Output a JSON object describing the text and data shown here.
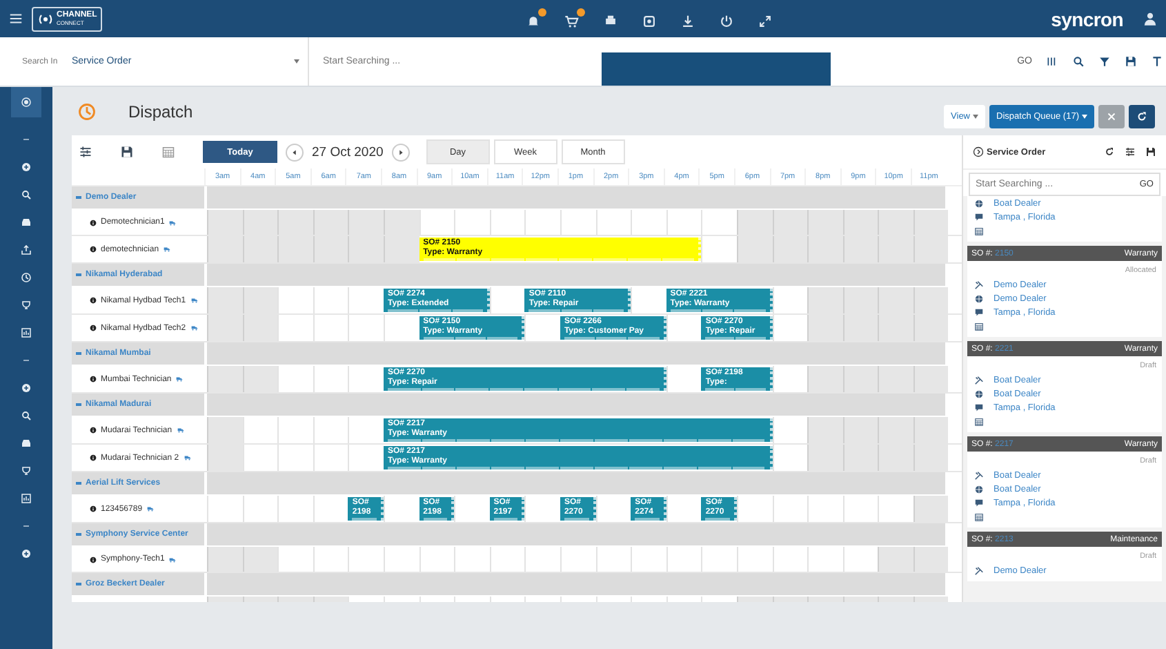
{
  "topbar": {
    "logo": "CHANNEL",
    "logo_sub": "CONNECT",
    "brand": "syncron",
    "notifications": [
      {
        "badge": true
      },
      {
        "badge": true
      },
      {
        "badge": false
      },
      {
        "badge": false
      },
      {
        "badge": false
      },
      {
        "badge": false
      },
      {
        "badge": false
      }
    ]
  },
  "searchbar": {
    "label": "Search In",
    "scope": "Service Order",
    "placeholder": "Start Searching ...",
    "go": "GO"
  },
  "page": {
    "title": "Dispatch",
    "view": "View",
    "queue": "Dispatch Queue (17)"
  },
  "toolbar": {
    "today": "Today",
    "date": "27 Oct 2020",
    "views": [
      {
        "label": "Day",
        "selected": true
      },
      {
        "label": "Week",
        "selected": false
      },
      {
        "label": "Month",
        "selected": false
      }
    ]
  },
  "hours": [
    "3am",
    "4am",
    "5am",
    "6am",
    "7am",
    "8am",
    "9am",
    "10am",
    "11am",
    "12pm",
    "1pm",
    "2pm",
    "3pm",
    "4pm",
    "5pm",
    "6pm",
    "7pm",
    "8pm",
    "9pm",
    "10pm",
    "11pm"
  ],
  "groups": [
    {
      "name": "Demo Dealer",
      "technicians": [
        {
          "name": "Demotechnician1",
          "slots": [
            {
              "available": false
            },
            {
              "available": false
            },
            {
              "available": false
            },
            {
              "available": false
            },
            {
              "available": false
            },
            {
              "available": false
            },
            {
              "available": true
            },
            {
              "available": true
            },
            {
              "available": true
            },
            {
              "available": true
            },
            {
              "available": true
            },
            {
              "available": true
            },
            {
              "available": true
            },
            {
              "available": true
            },
            {
              "available": true
            },
            {
              "available": false
            },
            {
              "available": false
            },
            {
              "available": false
            },
            {
              "available": false
            },
            {
              "available": false
            },
            {
              "available": false
            }
          ]
        },
        {
          "name": "demotechnician",
          "slots": [
            {
              "available": false
            },
            {
              "available": false
            },
            {
              "available": false
            },
            {
              "available": false
            },
            {
              "available": false
            },
            {
              "available": false
            },
            {
              "event": {
                "so": "SO# 2150",
                "type": "Type: Warranty",
                "color": "#ffff00"
              }
            },
            {
              "continued": true
            },
            {
              "continued": true
            },
            {
              "continued": true
            },
            {
              "continued": true
            },
            {
              "continued": true
            },
            {
              "continued": true
            },
            {
              "continued": true
            },
            {
              "available": true
            },
            {
              "available": false
            },
            {
              "available": false
            },
            {
              "available": false
            },
            {
              "available": false
            },
            {
              "available": false
            },
            {
              "available": false
            }
          ]
        }
      ]
    },
    {
      "name": "Nikamal Hyderabad",
      "technicians": [
        {
          "name": "Nikamal Hydbad Tech1",
          "slots": [
            {
              "available": false
            },
            {
              "available": false
            },
            {
              "available": true
            },
            {
              "available": true
            },
            {
              "available": true
            },
            {
              "event": {
                "so": "SO# 2274",
                "type": "Type: Extended",
                "color": "#1b8ea6"
              }
            },
            {
              "continued": true
            },
            {
              "continued": true
            },
            {
              "available": true
            },
            {
              "event": {
                "so": "SO# 2110",
                "type": "Type: Repair",
                "color": "#1b8ea6"
              }
            },
            {
              "continued": true
            },
            {
              "continued": true
            },
            {
              "available": true
            },
            {
              "event": {
                "so": "SO# 2221",
                "type": "Type: Warranty",
                "color": "#1b8ea6"
              }
            },
            {
              "continued": true
            },
            {
              "continued": true
            },
            {
              "available": true
            },
            {
              "available": false
            },
            {
              "available": false
            },
            {
              "available": false
            },
            {
              "available": false
            }
          ]
        },
        {
          "name": "Nikamal Hydbad Tech2",
          "slots": [
            {
              "available": false
            },
            {
              "available": false
            },
            {
              "available": true
            },
            {
              "available": true
            },
            {
              "available": true
            },
            {
              "available": true
            },
            {
              "event": {
                "so": "SO# 2150",
                "type": "Type: Warranty",
                "color": "#1b8ea6"
              }
            },
            {
              "continued": true
            },
            {
              "continued": true
            },
            {
              "available": true
            },
            {
              "event": {
                "so": "SO# 2266",
                "type": "Type: Customer Pay",
                "color": "#1b8ea6"
              }
            },
            {
              "continued": true
            },
            {
              "continued": true
            },
            {
              "available": true
            },
            {
              "event": {
                "so": "SO# 2270",
                "type": "Type: Repair",
                "color": "#1b8ea6"
              }
            },
            {
              "continued": true
            },
            {
              "available": true
            },
            {
              "available": false
            },
            {
              "available": false
            },
            {
              "available": false
            },
            {
              "available": false
            }
          ]
        }
      ]
    },
    {
      "name": "Nikamal Mumbai",
      "technicians": [
        {
          "name": "Mumbai Technician",
          "slots": [
            {
              "available": false
            },
            {
              "available": false
            },
            {
              "available": true
            },
            {
              "available": true
            },
            {
              "available": true
            },
            {
              "event": {
                "so": "SO# 2270",
                "type": "Type: Repair",
                "color": "#1b8ea6"
              }
            },
            {
              "continued": true
            },
            {
              "continued": true
            },
            {
              "continued": true
            },
            {
              "continued": true
            },
            {
              "continued": true
            },
            {
              "continued": true
            },
            {
              "continued": true
            },
            {
              "available": true
            },
            {
              "event": {
                "so": "SO# 2198",
                "type": "Type:",
                "color": "#1b8ea6"
              }
            },
            {
              "continued": true
            },
            {
              "available": true
            },
            {
              "available": false
            },
            {
              "available": false
            },
            {
              "available": false
            },
            {
              "available": false
            }
          ]
        }
      ]
    },
    {
      "name": "Nikamal Madurai",
      "technicians": [
        {
          "name": "Mudarai Technician",
          "slots": [
            {
              "available": false
            },
            {
              "available": true
            },
            {
              "available": true
            },
            {
              "available": true
            },
            {
              "available": true
            },
            {
              "event": {
                "so": "SO# 2217",
                "type": "Type: Warranty",
                "color": "#1b8ea6"
              }
            },
            {
              "continued": true
            },
            {
              "continued": true
            },
            {
              "continued": true
            },
            {
              "continued": true
            },
            {
              "continued": true
            },
            {
              "continued": true
            },
            {
              "continued": true
            },
            {
              "continued": true
            },
            {
              "continued": true
            },
            {
              "continued": true
            },
            {
              "available": true
            },
            {
              "available": false
            },
            {
              "available": false
            },
            {
              "available": false
            },
            {
              "available": false
            }
          ]
        },
        {
          "name": "Mudarai Technician 2",
          "slots": [
            {
              "available": false
            },
            {
              "available": true
            },
            {
              "available": true
            },
            {
              "available": true
            },
            {
              "available": true
            },
            {
              "event": {
                "so": "SO# 2217",
                "type": "Type: Warranty",
                "color": "#1b8ea6"
              }
            },
            {
              "continued": true
            },
            {
              "continued": true
            },
            {
              "continued": true
            },
            {
              "continued": true
            },
            {
              "continued": true
            },
            {
              "continued": true
            },
            {
              "continued": true
            },
            {
              "continued": true
            },
            {
              "continued": true
            },
            {
              "continued": true
            },
            {
              "available": true
            },
            {
              "available": false
            },
            {
              "available": false
            },
            {
              "available": false
            },
            {
              "available": false
            }
          ]
        }
      ]
    },
    {
      "name": "Aerial Lift Services",
      "technicians": [
        {
          "name": "123456789",
          "slots": [
            {
              "available": true
            },
            {
              "available": true
            },
            {
              "available": true
            },
            {
              "available": true
            },
            {
              "event": {
                "so": "SO# 2198",
                "color": "#1b8ea6"
              }
            },
            {
              "available": true
            },
            {
              "event": {
                "so": "SO# 2198",
                "color": "#1b8ea6"
              }
            },
            {
              "available": true
            },
            {
              "event": {
                "so": "SO# 2197",
                "color": "#1b8ea6"
              }
            },
            {
              "available": true
            },
            {
              "event": {
                "so": "SO# 2270",
                "color": "#1b8ea6"
              }
            },
            {
              "available": true
            },
            {
              "event": {
                "so": "SO# 2274",
                "color": "#1b8ea6"
              }
            },
            {
              "available": true
            },
            {
              "event": {
                "so": "SO# 2270",
                "color": "#1b8ea6"
              }
            },
            {
              "available": true
            },
            {
              "available": true
            },
            {
              "available": true
            },
            {
              "available": true
            },
            {
              "available": true
            },
            {
              "available": false
            }
          ]
        }
      ]
    },
    {
      "name": "Symphony Service Center",
      "technicians": [
        {
          "name": "Symphony-Tech1",
          "slots": [
            {
              "available": false
            },
            {
              "available": false
            },
            {
              "available": true
            },
            {
              "available": true
            },
            {
              "available": true
            },
            {
              "available": true
            },
            {
              "available": true
            },
            {
              "available": true
            },
            {
              "available": true
            },
            {
              "available": true
            },
            {
              "available": true
            },
            {
              "available": true
            },
            {
              "available": true
            },
            {
              "available": true
            },
            {
              "available": true
            },
            {
              "available": true
            },
            {
              "available": true
            },
            {
              "available": true
            },
            {
              "available": true
            },
            {
              "available": false
            },
            {
              "available": false
            }
          ]
        }
      ]
    },
    {
      "name": "Groz Beckert Dealer",
      "technicians": [
        {
          "slots": [
            {
              "available": false
            },
            {
              "available": false
            },
            {
              "available": false
            },
            {
              "available": false
            },
            {
              "available": true
            },
            {
              "available": true
            },
            {
              "available": true
            },
            {
              "available": true
            },
            {
              "available": true
            },
            {
              "available": true
            },
            {
              "available": true
            },
            {
              "available": true
            },
            {
              "available": true
            },
            {
              "available": true
            },
            {
              "available": true
            },
            {
              "available": false
            },
            {
              "available": false
            },
            {
              "available": false
            },
            {
              "available": false
            },
            {
              "available": false
            },
            {
              "available": false
            }
          ]
        }
      ]
    }
  ],
  "service_order_panel": {
    "title": "Service Order",
    "placeholder": "Start Searching ...",
    "go": "GO",
    "cards": [
      {
        "lines": [
          {
            "kind": "customer",
            "text": "Boat Dealer"
          },
          {
            "kind": "location",
            "text": "Tampa , Florida"
          },
          {
            "kind": "date"
          }
        ]
      },
      {
        "so_label": "SO #:",
        "so_number": "2150",
        "type": "Warranty",
        "status": "Allocated",
        "lines": [
          {
            "kind": "dealer",
            "text": "Demo Dealer"
          },
          {
            "kind": "customer",
            "text": "Demo Dealer"
          },
          {
            "kind": "location",
            "text": "Tampa , Florida"
          },
          {
            "kind": "date"
          }
        ]
      },
      {
        "so_label": "SO #:",
        "so_number": "2221",
        "type": "Warranty",
        "status": "Draft",
        "lines": [
          {
            "kind": "dealer",
            "text": "Boat Dealer"
          },
          {
            "kind": "customer",
            "text": "Boat Dealer"
          },
          {
            "kind": "location",
            "text": "Tampa , Florida"
          },
          {
            "kind": "date"
          }
        ]
      },
      {
        "so_label": "SO #:",
        "so_number": "2217",
        "type": "Warranty",
        "status": "Draft",
        "lines": [
          {
            "kind": "dealer",
            "text": "Boat Dealer"
          },
          {
            "kind": "customer",
            "text": "Boat Dealer"
          },
          {
            "kind": "location",
            "text": "Tampa , Florida"
          },
          {
            "kind": "date"
          }
        ]
      },
      {
        "so_label": "SO #:",
        "so_number": "2213",
        "type": "Maintenance",
        "status": "Draft",
        "lines": [
          {
            "kind": "dealer",
            "text": "Demo Dealer"
          }
        ]
      }
    ]
  }
}
